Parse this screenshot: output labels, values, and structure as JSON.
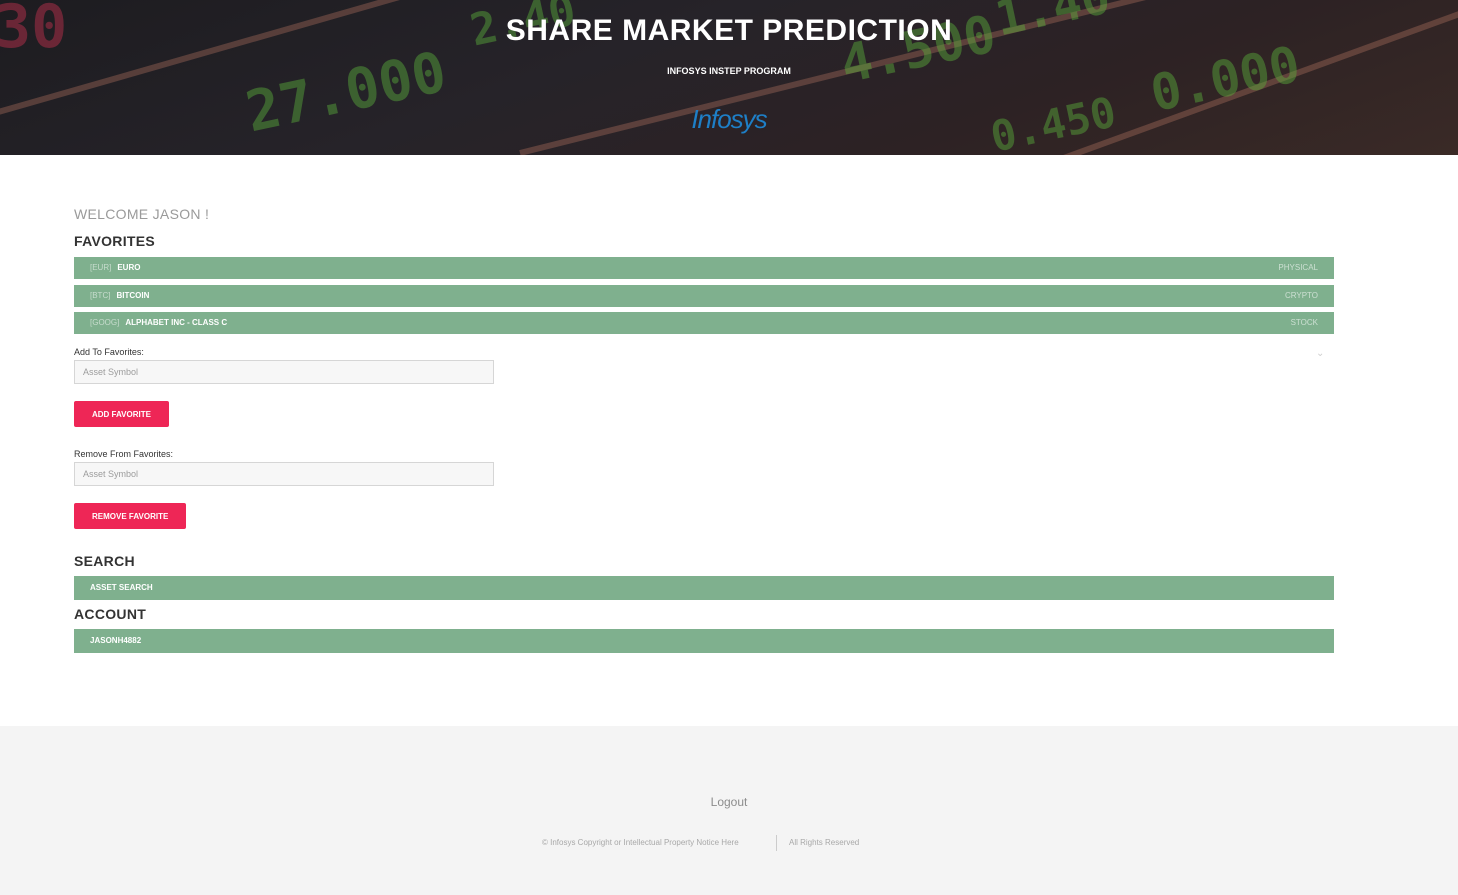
{
  "header": {
    "title": "SHARE MARKET PREDICTION",
    "subtitle": "INFOSYS INSTEP PROGRAM",
    "logo_text": "Infosys"
  },
  "welcome": "WELCOME JASON !",
  "favorites": {
    "title": "FAVORITES",
    "items": [
      {
        "symbol": "[EUR]",
        "name": "EURO",
        "type": "PHYSICAL"
      },
      {
        "symbol": "[BTC]",
        "name": "BITCOIN",
        "type": "CRYPTO"
      },
      {
        "symbol": "[GOOG]",
        "name": "ALPHABET INC - CLASS C",
        "type": "STOCK"
      }
    ],
    "add_label": "Add To Favorites:",
    "add_placeholder": "Asset Symbol",
    "add_button": "ADD FAVORITE",
    "remove_label": "Remove From Favorites:",
    "remove_placeholder": "Asset Symbol",
    "remove_button": "REMOVE FAVORITE"
  },
  "search": {
    "title": "SEARCH",
    "bar_label": "ASSET SEARCH"
  },
  "account": {
    "title": "ACCOUNT",
    "bar_label": "JASONH4882"
  },
  "footer": {
    "logout": "Logout",
    "copyright": "© Infosys Copyright or Intellectual Property Notice Here",
    "rights": "All Rights Reserved"
  },
  "colors": {
    "bar": "#7fb08e",
    "button": "#ee2656",
    "logo": "#1e7fc7"
  }
}
